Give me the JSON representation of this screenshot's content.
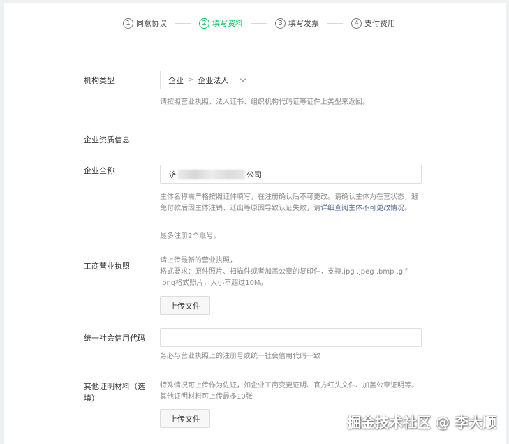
{
  "steps": [
    {
      "num": "1",
      "label": "同意协议",
      "active": false
    },
    {
      "num": "2",
      "label": "填写资料",
      "active": true
    },
    {
      "num": "3",
      "label": "填写发票",
      "active": false
    },
    {
      "num": "4",
      "label": "支付费用",
      "active": false
    }
  ],
  "org_type": {
    "label": "机构类型",
    "value_level1": "企业",
    "separator": ">",
    "value_level2": "企业法人",
    "help": "请按照营业执照、法人证书、组织机构代码证等证件上类型来返回。"
  },
  "section_title": "企业资质信息",
  "company_name": {
    "label": "企业全称",
    "value_prefix": "济",
    "value_suffix": "公司",
    "help_part1": "主体名称需严格按照证件填写，在注册确认后不可更改。请确认主体为在营状态，避免付款后因主体注销、迁出等原因导致认证失败，请",
    "help_link": "详细查阅主体不可更改情况",
    "help_part2": "。",
    "help_limit": "最多注册2个账号。"
  },
  "business_license": {
    "label": "工商营业执照",
    "help_line1": "请上传最新的营业执照，",
    "help_line2": "格式要求：原件照片、扫描件或者加盖公章的复印件，支持.jpg .jpeg .bmp .gif .png格式照片，大小不超过10M。",
    "upload_label": "上传文件"
  },
  "credit_code": {
    "label": "统一社会信用代码",
    "value": "",
    "help": "务必与营业执照上的注册号或统一社会信用代码一致"
  },
  "other_docs": {
    "label_line1": "其他证明材料（选",
    "label_line2": "填）",
    "help": "特殊情况可上传作为佐证，如企业工商变更证明、官方红头文件、加盖公章证明等。其他证明材料可上传最多10张",
    "upload_label": "上传文件"
  },
  "watermark": "掘金技术社区 @ 李大顺",
  "colors": {
    "accent": "#07c160",
    "link": "#576b95",
    "help_text": "#8a8a8a"
  }
}
